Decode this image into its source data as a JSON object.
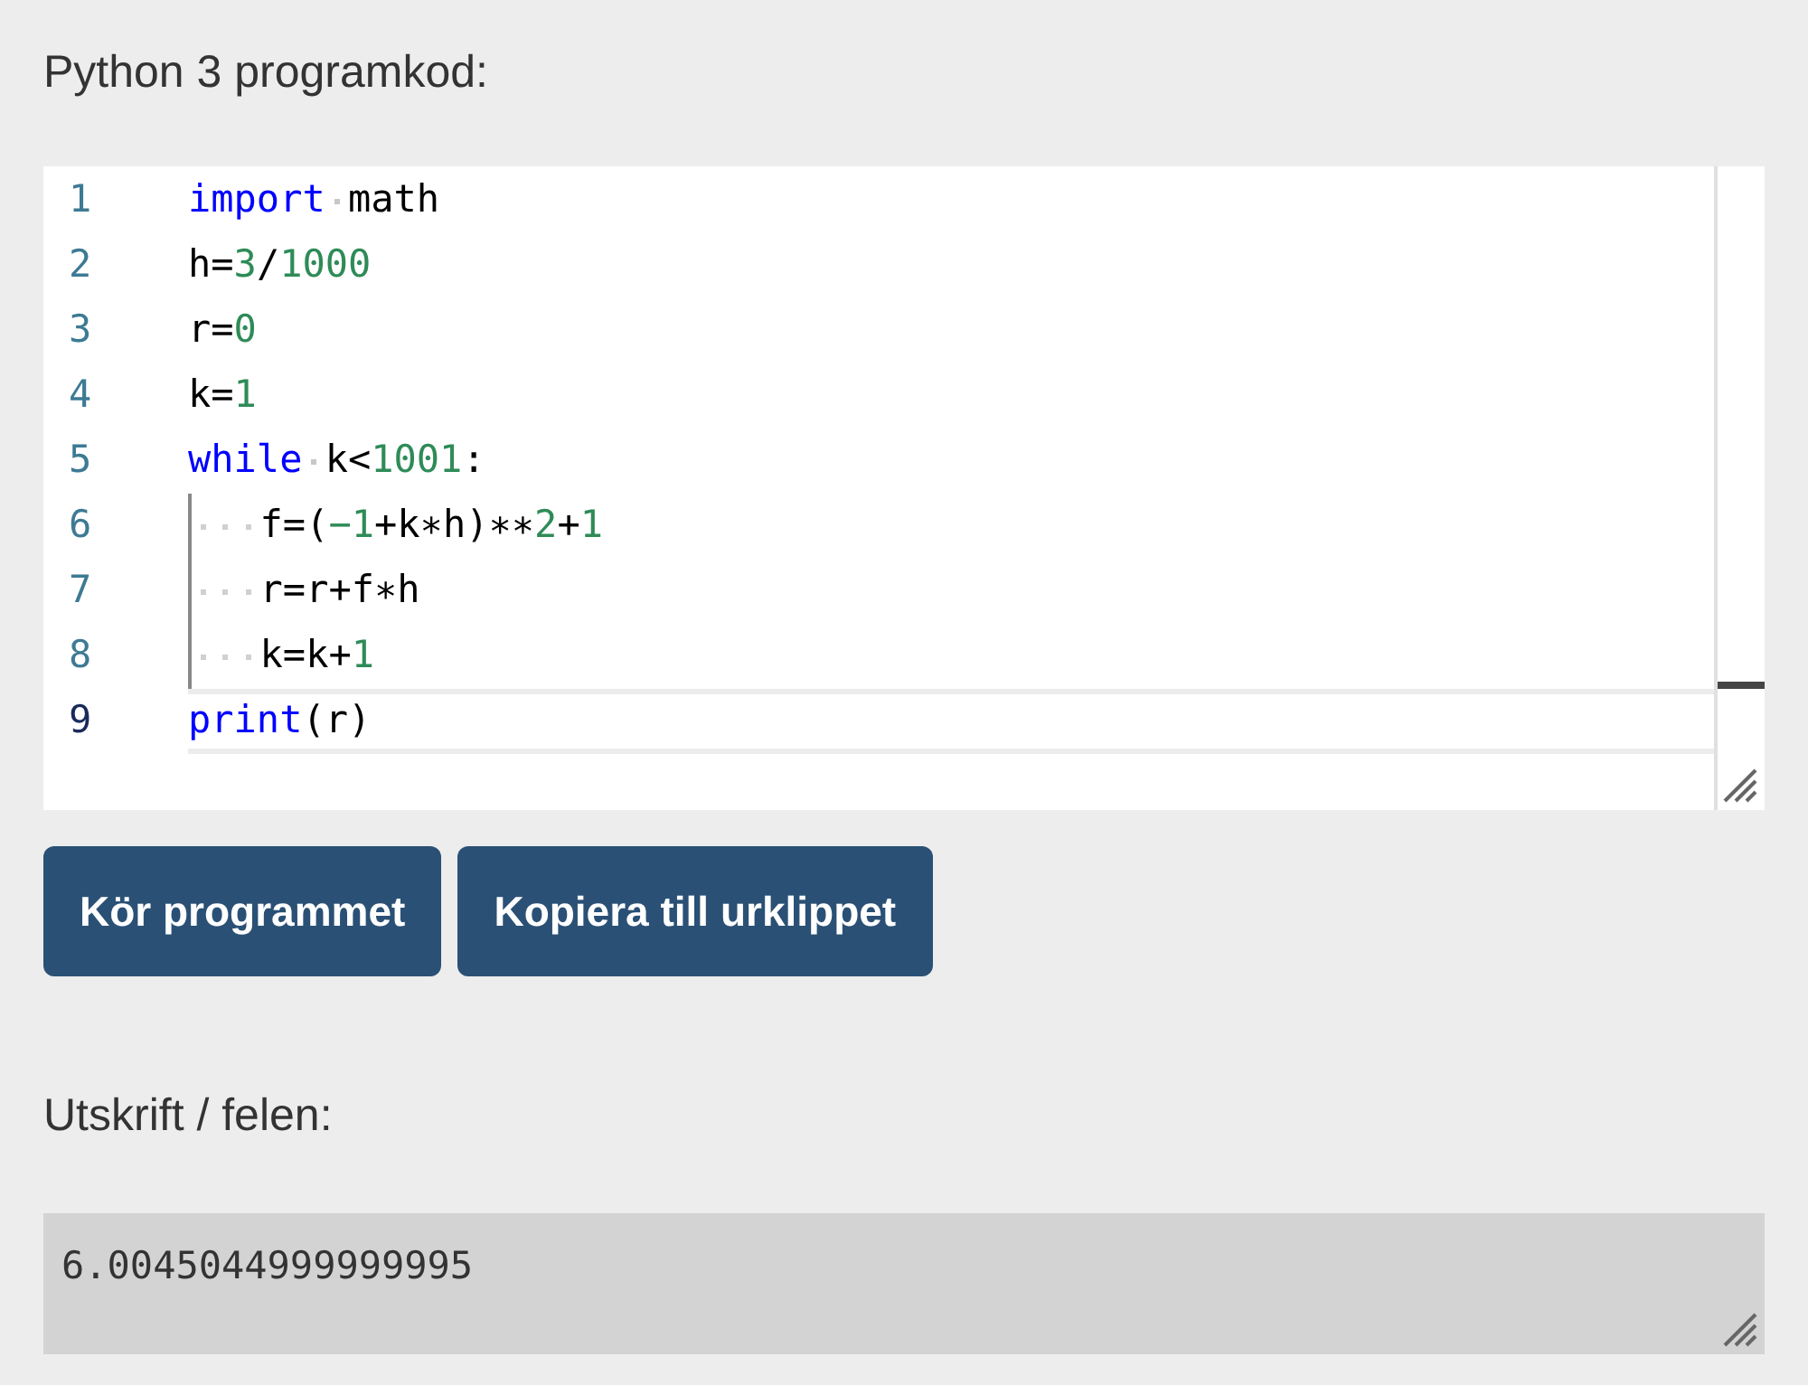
{
  "code_heading": "Python 3 programkod:",
  "editor": {
    "lines": [
      {
        "number": "1",
        "indented": false,
        "current": false,
        "tokens": [
          {
            "kind": "keyword",
            "text": "import"
          },
          {
            "kind": "space"
          },
          {
            "kind": "plain",
            "text": "math"
          }
        ]
      },
      {
        "number": "2",
        "indented": false,
        "current": false,
        "tokens": [
          {
            "kind": "plain",
            "text": "h="
          },
          {
            "kind": "number",
            "text": "3"
          },
          {
            "kind": "plain",
            "text": "/"
          },
          {
            "kind": "number",
            "text": "1000"
          }
        ]
      },
      {
        "number": "3",
        "indented": false,
        "current": false,
        "tokens": [
          {
            "kind": "plain",
            "text": "r="
          },
          {
            "kind": "number",
            "text": "0"
          }
        ]
      },
      {
        "number": "4",
        "indented": false,
        "current": false,
        "tokens": [
          {
            "kind": "plain",
            "text": "k="
          },
          {
            "kind": "number",
            "text": "1"
          }
        ]
      },
      {
        "number": "5",
        "indented": false,
        "current": false,
        "tokens": [
          {
            "kind": "keyword",
            "text": "while"
          },
          {
            "kind": "space"
          },
          {
            "kind": "plain",
            "text": "k<"
          },
          {
            "kind": "number",
            "text": "1001"
          },
          {
            "kind": "plain",
            "text": ":"
          }
        ]
      },
      {
        "number": "6",
        "indented": true,
        "current": false,
        "tokens": [
          {
            "kind": "plain",
            "text": "f=("
          },
          {
            "kind": "number",
            "text": "−1"
          },
          {
            "kind": "plain",
            "text": "+k∗h)∗∗"
          },
          {
            "kind": "number",
            "text": "2"
          },
          {
            "kind": "plain",
            "text": "+"
          },
          {
            "kind": "number",
            "text": "1"
          }
        ]
      },
      {
        "number": "7",
        "indented": true,
        "current": false,
        "tokens": [
          {
            "kind": "plain",
            "text": "r=r+f∗h"
          }
        ]
      },
      {
        "number": "8",
        "indented": true,
        "current": false,
        "tokens": [
          {
            "kind": "plain",
            "text": "k=k+"
          },
          {
            "kind": "number",
            "text": "1"
          }
        ]
      },
      {
        "number": "9",
        "indented": false,
        "current": true,
        "tokens": [
          {
            "kind": "keyword",
            "text": "print"
          },
          {
            "kind": "plain",
            "text": "(r)"
          }
        ]
      }
    ]
  },
  "buttons": [
    "Kör programmet",
    "Kopiera till urklippet"
  ],
  "output_heading": "Utskrift / felen:",
  "output": {
    "value": "6.0045044999999995"
  }
}
